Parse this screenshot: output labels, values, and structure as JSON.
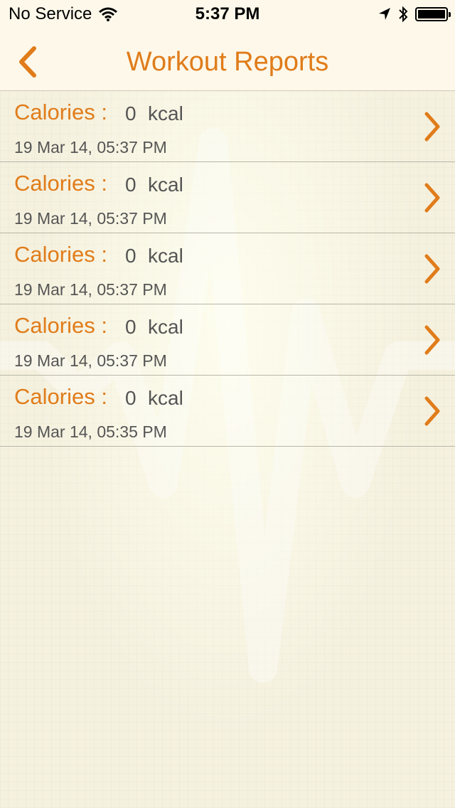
{
  "status_bar": {
    "carrier": "No Service",
    "time": "5:37 PM"
  },
  "nav": {
    "title": "Workout Reports"
  },
  "colors": {
    "accent": "#e07c1a",
    "text_secondary": "#555555"
  },
  "reports": [
    {
      "label": "Calories :",
      "value": "0",
      "unit": "kcal",
      "datetime": "19 Mar 14, 05:37 PM"
    },
    {
      "label": "Calories :",
      "value": "0",
      "unit": "kcal",
      "datetime": "19 Mar 14, 05:37 PM"
    },
    {
      "label": "Calories :",
      "value": "0",
      "unit": "kcal",
      "datetime": "19 Mar 14, 05:37 PM"
    },
    {
      "label": "Calories :",
      "value": "0",
      "unit": "kcal",
      "datetime": "19 Mar 14, 05:37 PM"
    },
    {
      "label": "Calories :",
      "value": "0",
      "unit": "kcal",
      "datetime": "19 Mar 14, 05:35 PM"
    }
  ]
}
